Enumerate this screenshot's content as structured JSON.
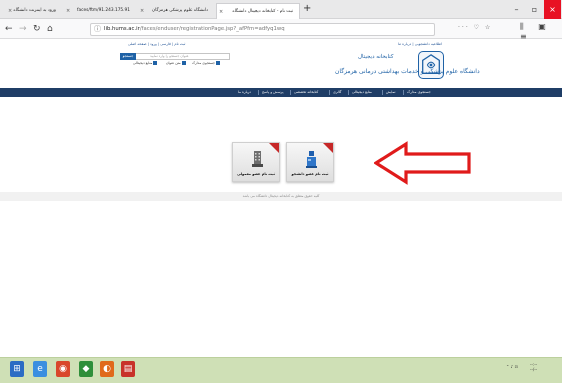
{
  "browser": {
    "tabs": [
      {
        "label": "ورود به اینترنت دانشگاه"
      },
      {
        "label": "91.243.175.91/faces/ftm"
      },
      {
        "label": "دانشگاه علوم پزشکی هرمزگان"
      },
      {
        "label": "ثبت نام - کتابخانه دیجیتال دانشگاه"
      }
    ],
    "new_tab": "+",
    "url_host": "lib.hums.ac.ir",
    "url_path": "/faces/enduser/registrationPage.jsp?_afPfm=adfyq1wq",
    "minimize": "–",
    "maximize": "▫",
    "close": "×"
  },
  "site": {
    "top_links": "اطلاعیه دانشجویی | درباره ما",
    "user_links": "ثبت نام | فارسی | ورود | صفحه اصلی",
    "search_placeholder": "عنوان جستجو را وارد نمایید",
    "search_button": "جستجو",
    "checkbox_1": "جستجوی مدارک",
    "checkbox_2": "متن عنوان",
    "checkbox_3": "منابع دیجیتالی",
    "library_name": "کتابخانه دیجیتال",
    "university_name": "دانشگاه علوم پزشکی و خدمات بهداشتی درمانی هرمزگان"
  },
  "nav": {
    "items": [
      "جستجوی مدارک",
      "نمایش",
      "منابع دیجیتالی",
      "گالری",
      "کتابخانه تخصصی",
      "پرسش و پاسخ",
      "درباره ما"
    ]
  },
  "cards": {
    "member": "ثبت نام عضو دانشجو",
    "staff": "ثبت نام عضو معمولی"
  },
  "footer": {
    "text": "کلیه حقوق متعلق به کتابخانه دیجیتال دانشگاه می باشد"
  },
  "colors": {
    "accent": "#1f3d66",
    "arrow": "#e01b1b",
    "close": "#e81123"
  }
}
